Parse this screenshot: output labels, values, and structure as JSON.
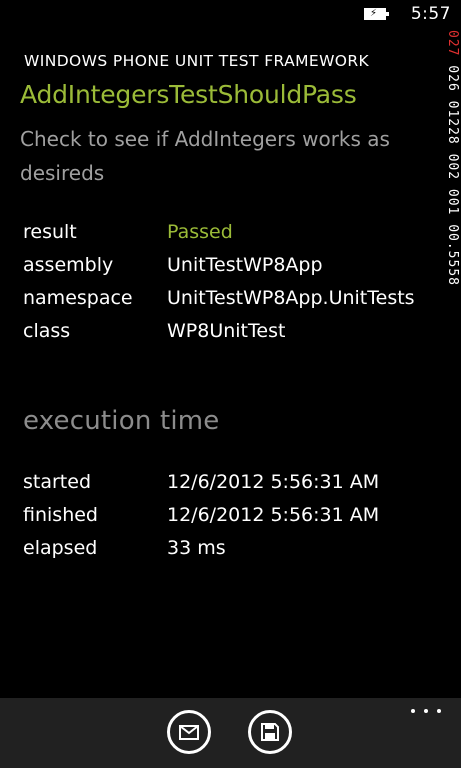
{
  "status_bar": {
    "time": "5:57",
    "battery_icon": "battery-charging-icon",
    "counter_red": "027",
    "counter_rest": " 026 01228 002 001 00.5558"
  },
  "app": {
    "title": "WINDOWS PHONE UNIT TEST FRAMEWORK",
    "accent_color": "#9bbb38"
  },
  "test": {
    "name": "AddIntegersTestShouldPass",
    "description": "Check to see if AddIntegers works as desireds"
  },
  "properties": [
    {
      "key": "result",
      "value": "Passed"
    },
    {
      "key": "assembly",
      "value": "UnitTestWP8App"
    },
    {
      "key": "namespace",
      "value": "UnitTestWP8App.UnitTests"
    },
    {
      "key": "class",
      "value": "WP8UnitTest"
    }
  ],
  "execution": {
    "title": "execution time",
    "rows": [
      {
        "key": "started",
        "value": "12/6/2012 5:56:31 AM"
      },
      {
        "key": "finished",
        "value": "12/6/2012 5:56:31 AM"
      },
      {
        "key": "elapsed",
        "value": "33 ms"
      }
    ]
  },
  "app_bar": {
    "buttons": [
      {
        "icon": "email-icon"
      },
      {
        "icon": "save-icon"
      }
    ],
    "more_icon": "ellipsis-icon"
  }
}
